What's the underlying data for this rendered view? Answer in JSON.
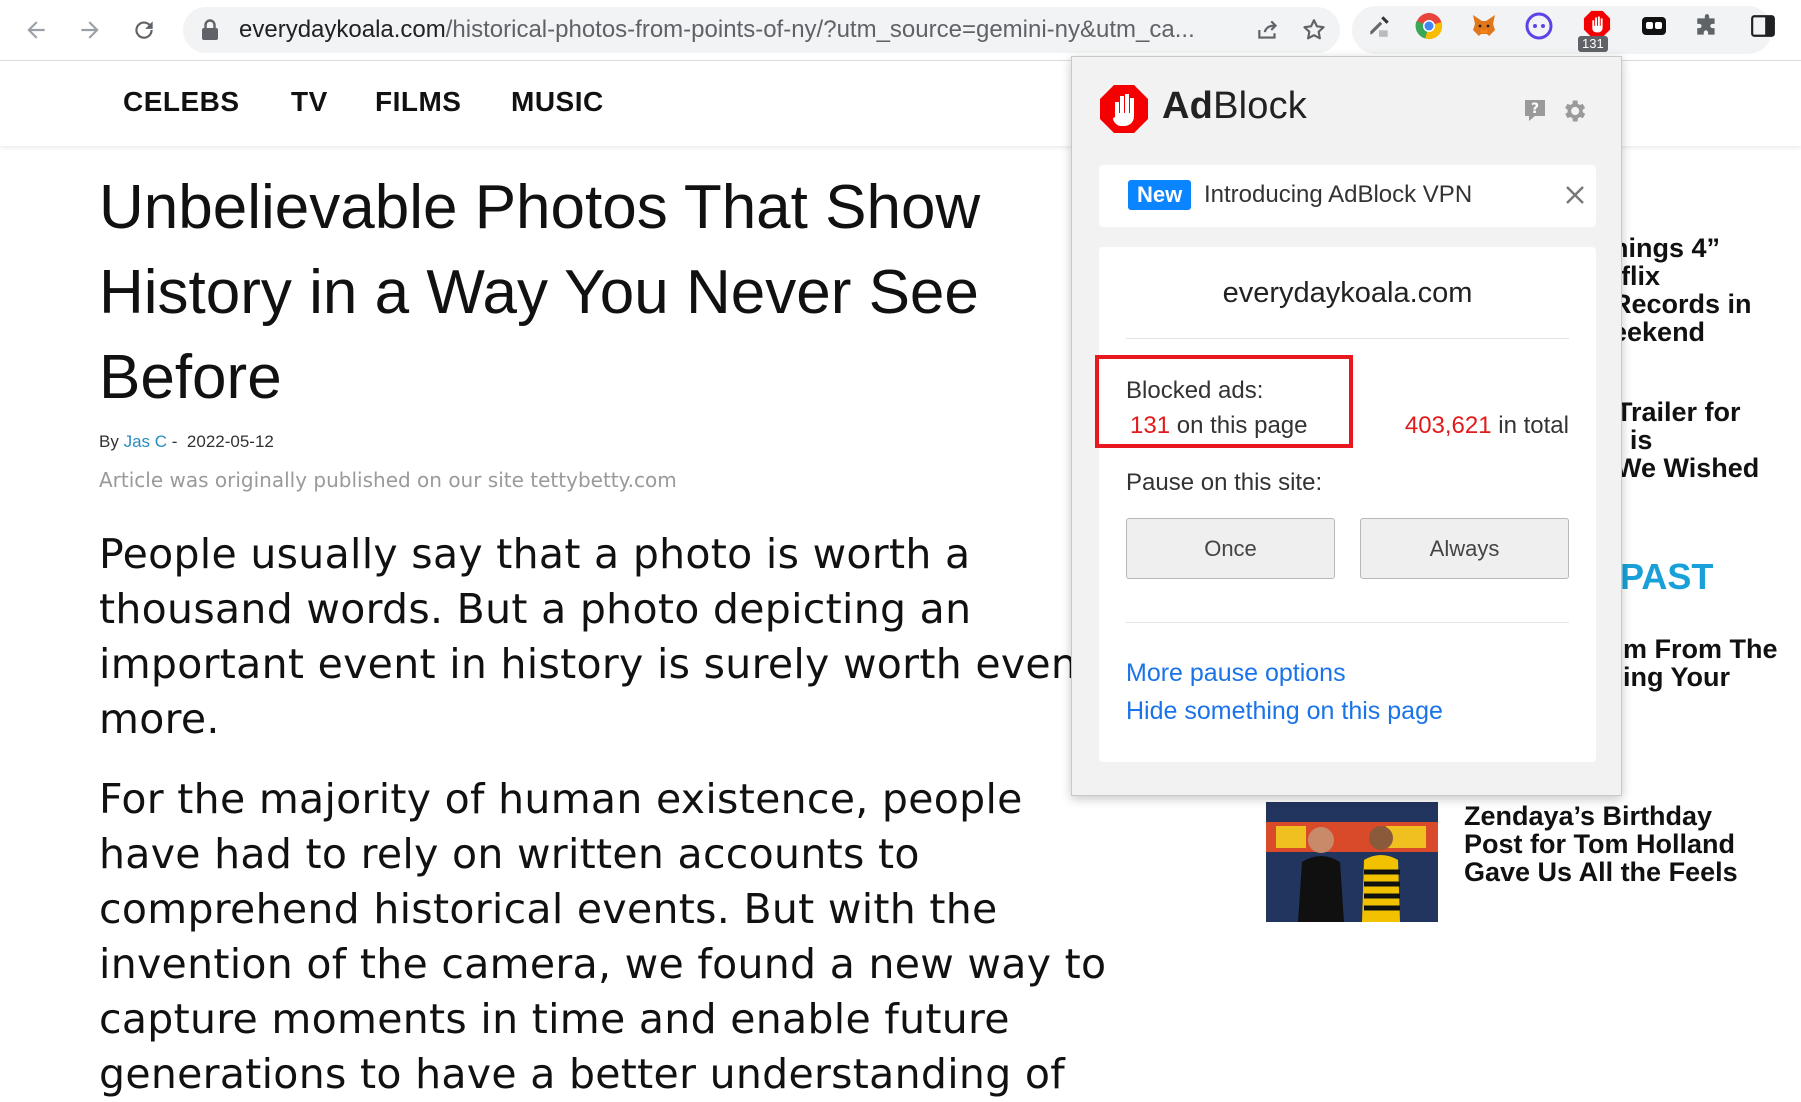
{
  "browser": {
    "url_host": "everydaykoala.com",
    "url_path": "/historical-photos-from-points-of-ny/?utm_source=gemini-ny&utm_ca...",
    "extension_badge_count": "131"
  },
  "site_nav": {
    "items": [
      "CELEBS",
      "TV",
      "FILMS",
      "MUSIC"
    ]
  },
  "article": {
    "title_lines": [
      "Unbelievable Photos That Show",
      "History in a Way You Never See",
      "Before"
    ],
    "byline_prefix": "By",
    "author": "Jas C",
    "date_sep": "-",
    "date": "2022-05-12",
    "origin_note": "Article was originally published on our site tettybetty.com",
    "paragraph1_lines": [
      "People usually say that a photo is worth a",
      "thousand words. But a photo depicting an",
      "important event in history is surely worth even",
      "more."
    ],
    "paragraph2_lines": [
      "For the majority of human existence, people",
      "have had to rely on written accounts to",
      "comprehend historical events. But with the",
      "invention of the camera, we found a new way to",
      "capture moments in time and enable future",
      "generations to have a better understanding of"
    ]
  },
  "sidebar": {
    "teaser1_lines": [
      "hings 4”",
      "tflix",
      "Records in",
      "eekend"
    ],
    "teaser2_lines": [
      "Trailer for",
      "' is",
      "We Wished"
    ],
    "section_heading": "PAST",
    "teaser3_lines": [
      "m From The",
      "ing Your"
    ],
    "teaser4_lines": [
      "Zendaya’s Birthday",
      "Post for Tom Holland",
      "Gave Us All the Feels"
    ]
  },
  "adblock": {
    "brand_bold": "Ad",
    "brand_rest": "Block",
    "banner_badge": "New",
    "banner_text": "Introducing AdBlock VPN",
    "domain": "everydaykoala.com",
    "blocked_label": "Blocked ads:",
    "page_count": "131",
    "page_suffix": " on this page",
    "total_count": "403,621",
    "total_suffix": " in total",
    "pause_label": "Pause on this site:",
    "once_label": "Once",
    "always_label": "Always",
    "more_pause_link": "More pause options",
    "hide_link": "Hide something on this page"
  },
  "colors": {
    "adblock_red": "#e11a1a",
    "link_blue": "#1a73e8",
    "new_badge_blue": "#0a84ff",
    "sidebar_heading_blue": "#1aa0d8"
  },
  "icons": [
    "back-arrow-icon",
    "forward-arrow-icon",
    "reload-icon",
    "lock-icon",
    "share-icon",
    "bookmark-star-icon",
    "eyedropper-icon",
    "chrome-ext-icon",
    "metamask-fox-icon",
    "ext-circle-icon",
    "adblock-hand-icon",
    "ext-mask-icon",
    "puzzle-extensions-icon",
    "side-panel-icon",
    "help-icon",
    "gear-icon",
    "close-icon"
  ]
}
